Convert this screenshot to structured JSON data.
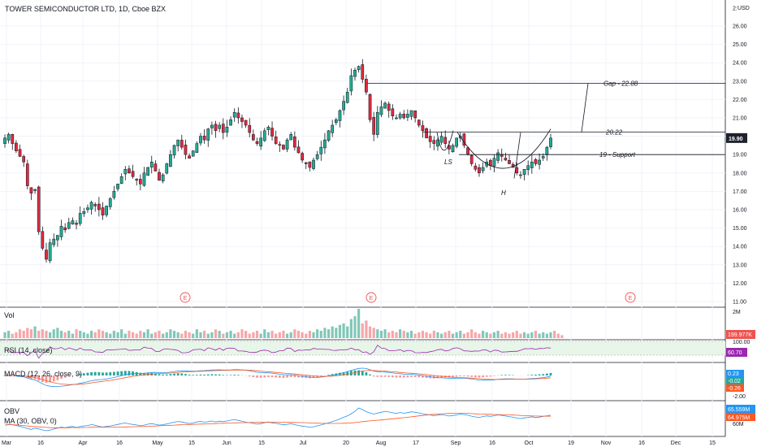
{
  "title": "TOWER SEMICONDUCTOR LTD, 1D, Cboe BZX",
  "currency": "USD",
  "colors": {
    "up": "#26a69a",
    "down": "#ef5350",
    "candle_up": "#22ab94",
    "candle_down": "#e0293d",
    "grid": "#f0f3fa",
    "line": "#131722",
    "rsi": "#9c27b0",
    "macd": "#2196f3",
    "signal": "#ff5722",
    "obv": "#2196f3",
    "obv_ma": "#ff5722",
    "vol_up": "#81c7b8",
    "vol_down": "#f7a6a8"
  },
  "badges": {
    "price": "19.90",
    "volume": "199.977K",
    "rsi": "60.70",
    "macd": "0.23",
    "macd_signal": "-0.02",
    "macd_hist": "-0.26",
    "obv": "65.559M",
    "obv_ma": "64.975M"
  },
  "panes": {
    "vol": "Vol",
    "rsi": "RSI (14, close)",
    "macd": "MACD (12, 26, close, 9)",
    "obv": "OBV",
    "obv_ma": "MA (30, OBV, 0)"
  },
  "annotations": {
    "gap": "Gap - 22.88",
    "level": "20.22",
    "support": "19 - Support",
    "ls": "LS",
    "h": "H",
    "earnings": "E"
  },
  "x_labels": [
    "Mar",
    "16",
    "Apr",
    "16",
    "May",
    "15",
    "Jun",
    "15",
    "Jul",
    "20",
    "Aug",
    "17",
    "Sep",
    "16",
    "Oct",
    "19",
    "Nov",
    "16",
    "Dec",
    "15"
  ],
  "y_axis": {
    "price_ticks": [
      "2:",
      "26.00",
      "25.00",
      "24.00",
      "23.00",
      "22.00",
      "21.00",
      "20.00",
      "19.00",
      "18.00",
      "17.00",
      "16.00",
      "15.00",
      "14.00",
      "13.00",
      "12.00",
      "11.00"
    ],
    "vol_ticks": [
      "2M"
    ],
    "rsi_ticks": [
      "100.00"
    ],
    "macd_ticks": [
      "-2.00"
    ],
    "obv_ticks": [
      "60M"
    ]
  },
  "chart_data": {
    "type": "candlestick",
    "title": "TOWER SEMICONDUCTOR LTD, 1D, Cboe BZX",
    "ylim": [
      11,
      27
    ],
    "closes": [
      19.9,
      20.1,
      19.6,
      19.2,
      18.9,
      18.6,
      17.3,
      16.9,
      17.1,
      14.8,
      13.9,
      13.3,
      14.2,
      14.4,
      14.6,
      15.1,
      14.9,
      15.3,
      15.4,
      15.2,
      15.8,
      15.9,
      16.1,
      16.4,
      16.2,
      16.0,
      15.7,
      16.2,
      16.6,
      17.0,
      17.4,
      17.8,
      18.2,
      18.0,
      17.8,
      17.6,
      17.4,
      18.0,
      18.3,
      18.6,
      18.1,
      17.6,
      17.9,
      18.5,
      19.0,
      19.5,
      19.8,
      19.4,
      19.0,
      18.8,
      19.2,
      19.6,
      20.0,
      19.8,
      20.4,
      20.6,
      20.3,
      20.6,
      20.2,
      20.5,
      20.9,
      21.3,
      21.0,
      20.8,
      20.6,
      20.2,
      19.8,
      19.6,
      19.9,
      20.3,
      20.5,
      20.0,
      19.6,
      19.5,
      19.3,
      19.8,
      20.1,
      19.4,
      19.1,
      18.7,
      18.5,
      18.3,
      18.7,
      19.0,
      19.4,
      19.8,
      20.3,
      20.6,
      20.9,
      21.4,
      21.9,
      22.4,
      23.3,
      23.6,
      23.8,
      23.1,
      22.4,
      20.9,
      20.1,
      21.3,
      21.6,
      21.8,
      21.4,
      21.1,
      21.0,
      21.2,
      21.0,
      21.2,
      21.4,
      21.0,
      20.6,
      20.3,
      19.9,
      19.7,
      19.6,
      19.8,
      20.0,
      19.6,
      19.3,
      19.5,
      19.9,
      20.0,
      19.5,
      19.0,
      18.5,
      18.2,
      18.0,
      18.3,
      18.6,
      18.4,
      18.8,
      19.1,
      18.9,
      18.7,
      18.5,
      18.3,
      18.0,
      17.9,
      18.2,
      18.4,
      18.6,
      18.5,
      18.7,
      18.9,
      19.4,
      19.9
    ],
    "volumes": [
      0.4,
      0.5,
      0.3,
      0.4,
      0.6,
      0.5,
      0.7,
      0.6,
      0.8,
      0.5,
      0.6,
      0.5,
      0.4,
      0.6,
      0.7,
      0.5,
      0.4,
      0.5,
      0.3,
      0.6,
      0.5,
      0.4,
      0.3,
      0.5,
      0.4,
      0.6,
      0.5,
      0.4,
      0.3,
      0.5,
      0.4,
      0.6,
      0.3,
      0.5,
      0.4,
      0.3,
      0.5,
      0.4,
      0.6,
      0.3,
      0.4,
      0.5,
      0.3,
      0.4,
      0.6,
      0.5,
      0.4,
      0.3,
      0.5,
      0.4,
      0.3,
      0.6,
      0.4,
      0.5,
      0.3,
      0.4,
      0.6,
      0.5,
      0.3,
      0.4,
      0.5,
      0.3,
      0.4,
      0.6,
      0.5,
      0.3,
      0.4,
      0.5,
      0.3,
      0.6,
      0.4,
      0.5,
      0.3,
      0.4,
      0.5,
      0.3,
      0.4,
      0.6,
      0.5,
      0.4,
      0.3,
      0.5,
      0.4,
      0.6,
      0.5,
      0.7,
      0.6,
      0.8,
      0.7,
      0.9,
      1.0,
      0.8,
      1.3,
      1.5,
      2.0,
      1.0,
      1.2,
      0.8,
      0.7,
      0.6,
      0.5,
      0.6,
      0.4,
      0.5,
      0.4,
      0.6,
      0.5,
      0.4,
      0.5,
      0.3,
      0.4,
      0.5,
      0.4,
      0.3,
      0.5,
      0.4,
      0.3,
      0.4,
      0.5,
      0.3,
      0.4,
      0.5,
      0.3,
      0.4,
      0.6,
      0.4,
      0.3,
      0.5,
      0.4,
      0.3,
      0.4,
      0.5,
      0.3,
      0.4,
      0.3,
      0.4,
      0.5,
      0.3,
      0.4,
      0.3,
      0.4,
      0.5,
      0.3,
      0.4,
      0.3,
      0.4,
      0.5,
      0.3,
      0.2
    ],
    "gap_level": 22.88,
    "level_2022": 20.22,
    "support_level": 19.0
  }
}
